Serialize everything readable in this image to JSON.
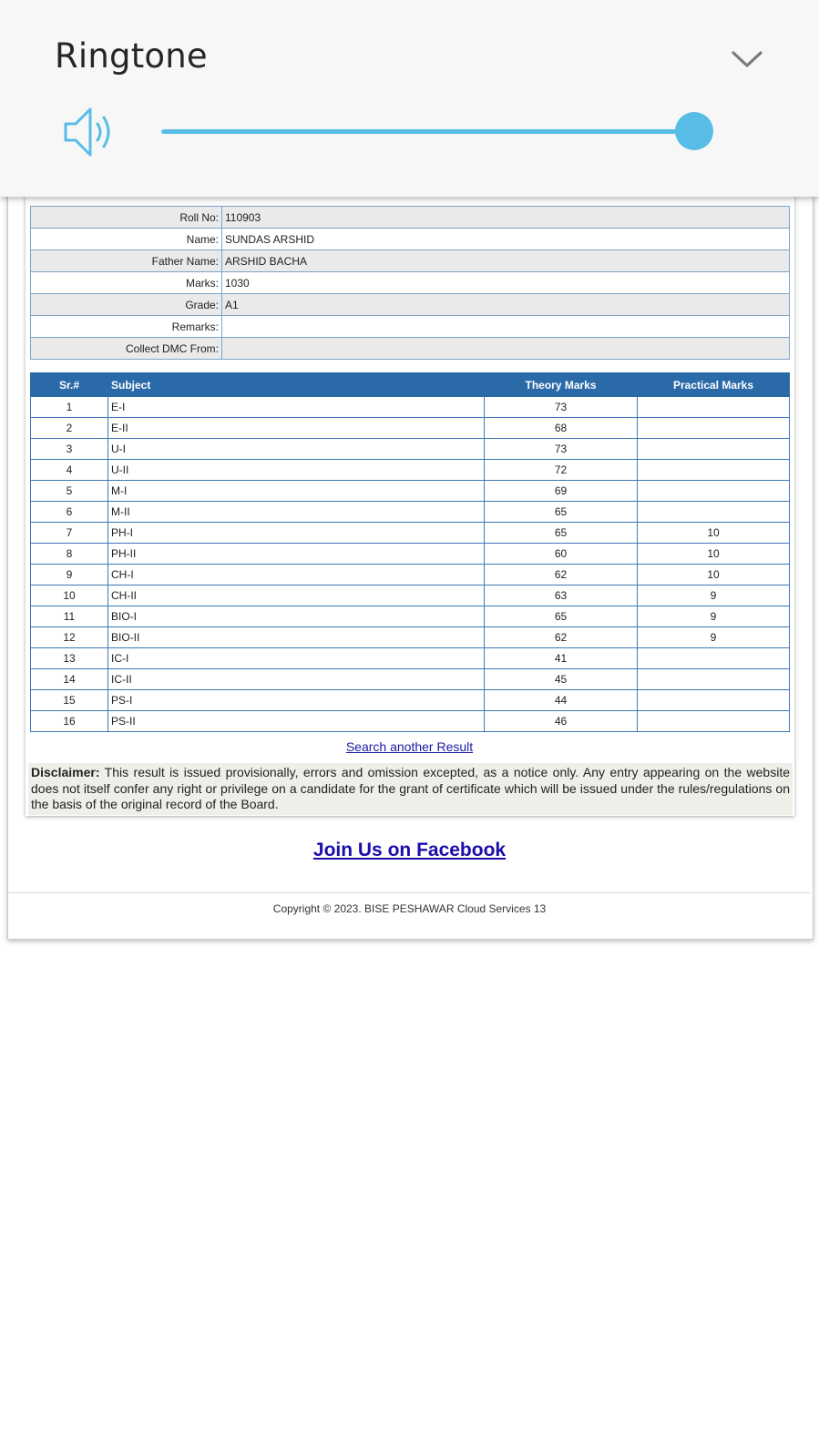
{
  "volume_panel": {
    "title": "Ringtone",
    "level": 1.0,
    "accent_color": "#58bde6",
    "icons": {
      "speaker": "speaker-icon",
      "collapse": "chevron-down-icon"
    }
  },
  "student_info": [
    {
      "label": "Roll No:",
      "value": "110903"
    },
    {
      "label": "Name:",
      "value": "SUNDAS ARSHID"
    },
    {
      "label": "Father Name:",
      "value": "ARSHID BACHA"
    },
    {
      "label": "Marks:",
      "value": "1030"
    },
    {
      "label": "Grade:",
      "value": "A1"
    },
    {
      "label": "Remarks:",
      "value": ""
    },
    {
      "label": "Collect DMC From:",
      "value": ""
    }
  ],
  "marks_table": {
    "header_color": "#2a6aa8",
    "columns": [
      "Sr.#",
      "Subject",
      "Theory Marks",
      "Practical Marks"
    ],
    "rows": [
      {
        "sr": "1",
        "subject": "E-I",
        "theory": "73",
        "practical": ""
      },
      {
        "sr": "2",
        "subject": "E-II",
        "theory": "68",
        "practical": ""
      },
      {
        "sr": "3",
        "subject": "U-I",
        "theory": "73",
        "practical": ""
      },
      {
        "sr": "4",
        "subject": "U-II",
        "theory": "72",
        "practical": ""
      },
      {
        "sr": "5",
        "subject": "M-I",
        "theory": "69",
        "practical": ""
      },
      {
        "sr": "6",
        "subject": "M-II",
        "theory": "65",
        "practical": ""
      },
      {
        "sr": "7",
        "subject": "PH-I",
        "theory": "65",
        "practical": "10"
      },
      {
        "sr": "8",
        "subject": "PH-II",
        "theory": "60",
        "practical": "10"
      },
      {
        "sr": "9",
        "subject": "CH-I",
        "theory": "62",
        "practical": "10"
      },
      {
        "sr": "10",
        "subject": "CH-II",
        "theory": "63",
        "practical": "9"
      },
      {
        "sr": "11",
        "subject": "BIO-I",
        "theory": "65",
        "practical": "9"
      },
      {
        "sr": "12",
        "subject": "BIO-II",
        "theory": "62",
        "practical": "9"
      },
      {
        "sr": "13",
        "subject": "IC-I",
        "theory": "41",
        "practical": ""
      },
      {
        "sr": "14",
        "subject": "IC-II",
        "theory": "45",
        "practical": ""
      },
      {
        "sr": "15",
        "subject": "PS-I",
        "theory": "44",
        "practical": ""
      },
      {
        "sr": "16",
        "subject": "PS-II",
        "theory": "46",
        "practical": ""
      }
    ]
  },
  "links": {
    "search_another": "Search another Result",
    "facebook": "Join Us on Facebook"
  },
  "disclaimer": {
    "label": "Disclaimer:",
    "text": "This result is issued provisionally, errors and omission excepted, as a notice only. Any entry appearing on the website does not itself confer any right or privilege on a candidate for the grant of certificate which will be issued under the rules/regulations on the basis of the original record of the Board."
  },
  "footer": {
    "copyright": "Copyright © 2023. BISE PESHAWAR Cloud Services 13"
  }
}
